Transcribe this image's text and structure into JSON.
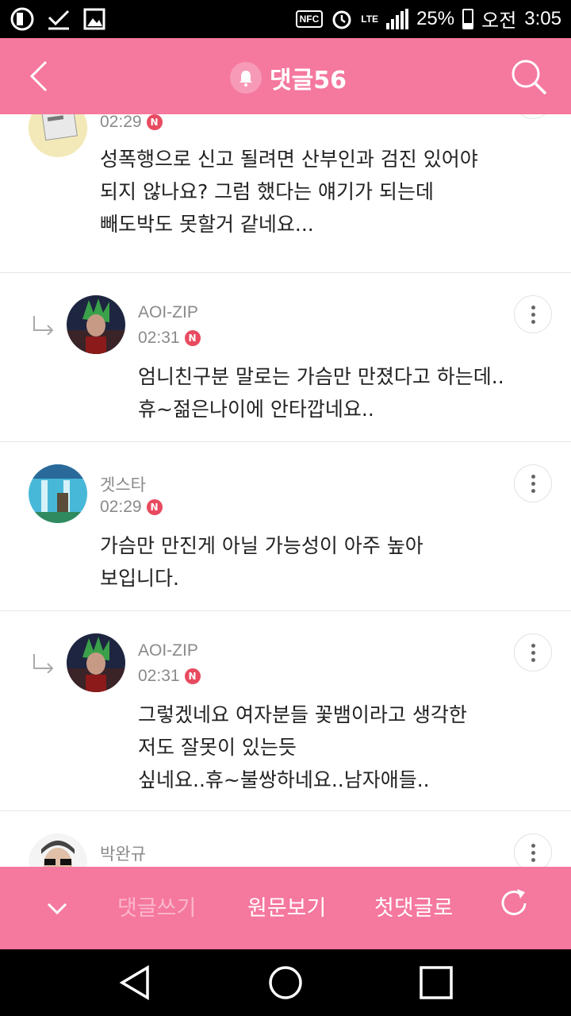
{
  "status_bar": {
    "battery": "25%",
    "ampm": "오전",
    "time": "3:05",
    "nfc": "NFC",
    "lte": "LTE",
    "battery_level": 0.25,
    "icons": [
      "u-plus-icon",
      "download-done-icon",
      "image-icon",
      "nfc-icon",
      "alarm-icon",
      "lte-icon",
      "signal-icon",
      "battery-icon"
    ]
  },
  "header": {
    "title": "댓글56",
    "icons": [
      "back-icon",
      "bell-icon",
      "search-icon"
    ]
  },
  "comments": [
    {
      "author": "",
      "time": "02:29",
      "badge": "N",
      "text": "성폭행으로 신고 될려면 산부인과 검진 있어야\n되지 않나요? 그럼 했다는 얘기가 되는데\n빼도박도 못할거 같네요...",
      "is_reply": false
    },
    {
      "author": "AOI-ZIP",
      "time": "02:31",
      "badge": "N",
      "text": "엄니친구분 말로는 가슴만 만졌다고 하는데..\n휴~젊은나이에 안타깝네요..",
      "is_reply": true
    },
    {
      "author": "겟스타",
      "time": "02:29",
      "badge": "N",
      "text": "가슴만 만진게 아닐 가능성이 아주 높아\n보입니다.",
      "is_reply": false
    },
    {
      "author": "AOI-ZIP",
      "time": "02:31",
      "badge": "N",
      "text": "그렇겠네요 여자분들 꽃뱀이라고 생각한\n저도 잘못이 있는듯\n싶네요..휴~불쌍하네요..남자애들..",
      "is_reply": true
    },
    {
      "author": "박완규",
      "time": "",
      "badge": "",
      "text": "",
      "is_reply": false
    }
  ],
  "bottom_bar": {
    "write": "댓글쓰기",
    "original": "원문보기",
    "first": "첫댓글로",
    "icons": [
      "chevron-down-icon",
      "refresh-icon"
    ]
  },
  "nav_bar": {
    "icons": [
      "back-triangle-icon",
      "home-circle-icon",
      "recents-square-icon"
    ]
  },
  "colors": {
    "accent": "#f5789f",
    "badge": "#e84a5f"
  }
}
